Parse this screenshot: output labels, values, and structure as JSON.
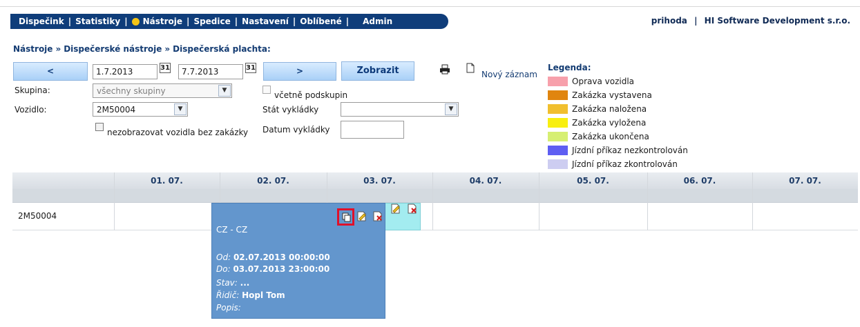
{
  "nav": {
    "items": [
      "Dispečink",
      "Statistiky",
      "Nástroje",
      "Spedice",
      "Nastavení",
      "Oblíbené",
      "Admin"
    ],
    "user": "prihoda",
    "company": "HI Software Development s.r.o.",
    "user_separator": "|"
  },
  "breadcrumb": [
    "Nástroje",
    "Dispečerské nástroje",
    "Dispečerská plachta:"
  ],
  "breadcrumb_sep": "»",
  "filter": {
    "prev_label": "<",
    "next_label": ">",
    "show_label": "Zobrazit",
    "date_from": "1.7.2013",
    "date_to": "7.7.2013",
    "calendar_icon_text": "31",
    "group_label": "Skupina:",
    "group_value": "všechny skupiny",
    "subgroups_label": "včetně podskupin",
    "vehicle_label": "Vozidlo:",
    "vehicle_value": "2M50004",
    "hide_vehicles_label": "nezobrazovat vozidla bez zakázky",
    "state_label": "Stát vykládky",
    "state_value": "",
    "date_unload_label": "Datum vykládky",
    "date_unload_value": "",
    "new_record_label": "Nový záznam"
  },
  "legend": {
    "title": "Legenda:",
    "items": [
      {
        "label": "Oprava vozidla",
        "color": "#f7a0ab"
      },
      {
        "label": "Zakázka vystavena",
        "color": "#e0850f"
      },
      {
        "label": "Zakázka naložena",
        "color": "#f1bf2e"
      },
      {
        "label": "Zakázka vyložena",
        "color": "#f8ef10"
      },
      {
        "label": "Zakázka ukončena",
        "color": "#d6ef72"
      },
      {
        "label": "Jízdní příkaz nezkontrolován",
        "color": "#5e5ef2"
      },
      {
        "label": "Jízdní příkaz zkontrolován",
        "color": "#cdcdf1"
      }
    ]
  },
  "grid": {
    "days": [
      "01. 07.",
      "02. 07.",
      "03. 07.",
      "04. 07.",
      "05. 07.",
      "06. 07.",
      "07. 07."
    ],
    "rows": [
      {
        "vehicle": "2M50004"
      }
    ]
  },
  "popup": {
    "route": "CZ - CZ",
    "from_label": "Od:",
    "from_value": "02.07.2013 00:00:00",
    "to_label": "Do:",
    "to_value": "03.07.2013 23:00:00",
    "state_label": "Stav:",
    "state_value": "...",
    "driver_label": "Řidič:",
    "driver_value": "Hopl Tom",
    "desc_label": "Popis:",
    "desc_value": ""
  },
  "colors": {
    "nav_bg": "#0f3d7a",
    "popup_bg": "#6396cd",
    "bar_bg": "#a3ecf0",
    "highlight": "#e0102a"
  }
}
